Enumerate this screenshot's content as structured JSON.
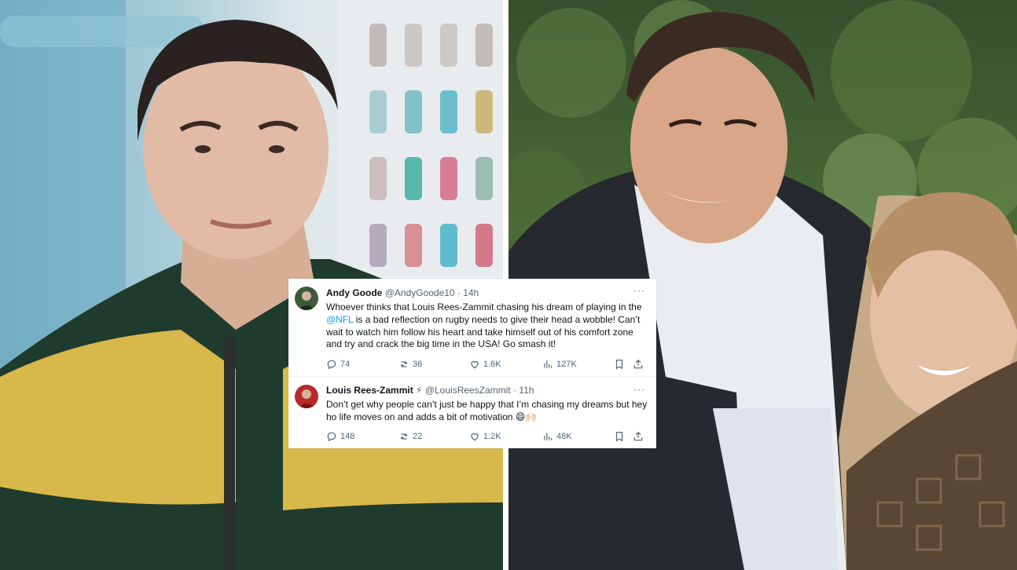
{
  "tweets": [
    {
      "name": "Andy Goode",
      "handle": "@AndyGoode10",
      "separator": "·",
      "time": "14h",
      "text_before_mention": "Whoever thinks that Louis Rees-Zammit chasing his dream of playing in the ",
      "mention": "@NFL",
      "text_after_mention": " is a bad reflection on rugby needs to give their head a wobble! Can’t wait to watch him follow his heart and take himself out of his comfort zone and try and crack the big time in the USA! Go smash it!",
      "more_label": "···",
      "replies": "74",
      "reposts": "36",
      "likes": "1.6K",
      "views": "127K"
    },
    {
      "name": "Louis Rees-Zammit",
      "badge_emoji": "⚡",
      "handle": "@LouisReesZammit",
      "separator": "·",
      "time": "11h",
      "text": "Don’t get why people can’t just be happy that I’m chasing my dreams but hey ho life moves on and adds a bit of motivation 😄🙌🏻",
      "more_label": "···",
      "replies": "148",
      "reposts": "22",
      "likes": "1.2K",
      "views": "48K"
    }
  ],
  "colors": {
    "text_primary": "#0f1419",
    "text_secondary": "#536471",
    "link": "#1d9bf0",
    "card_background": "#ffffff"
  },
  "icons": [
    "reply-icon",
    "repost-icon",
    "like-icon",
    "views-icon",
    "bookmark-icon",
    "share-icon",
    "more-icon"
  ]
}
